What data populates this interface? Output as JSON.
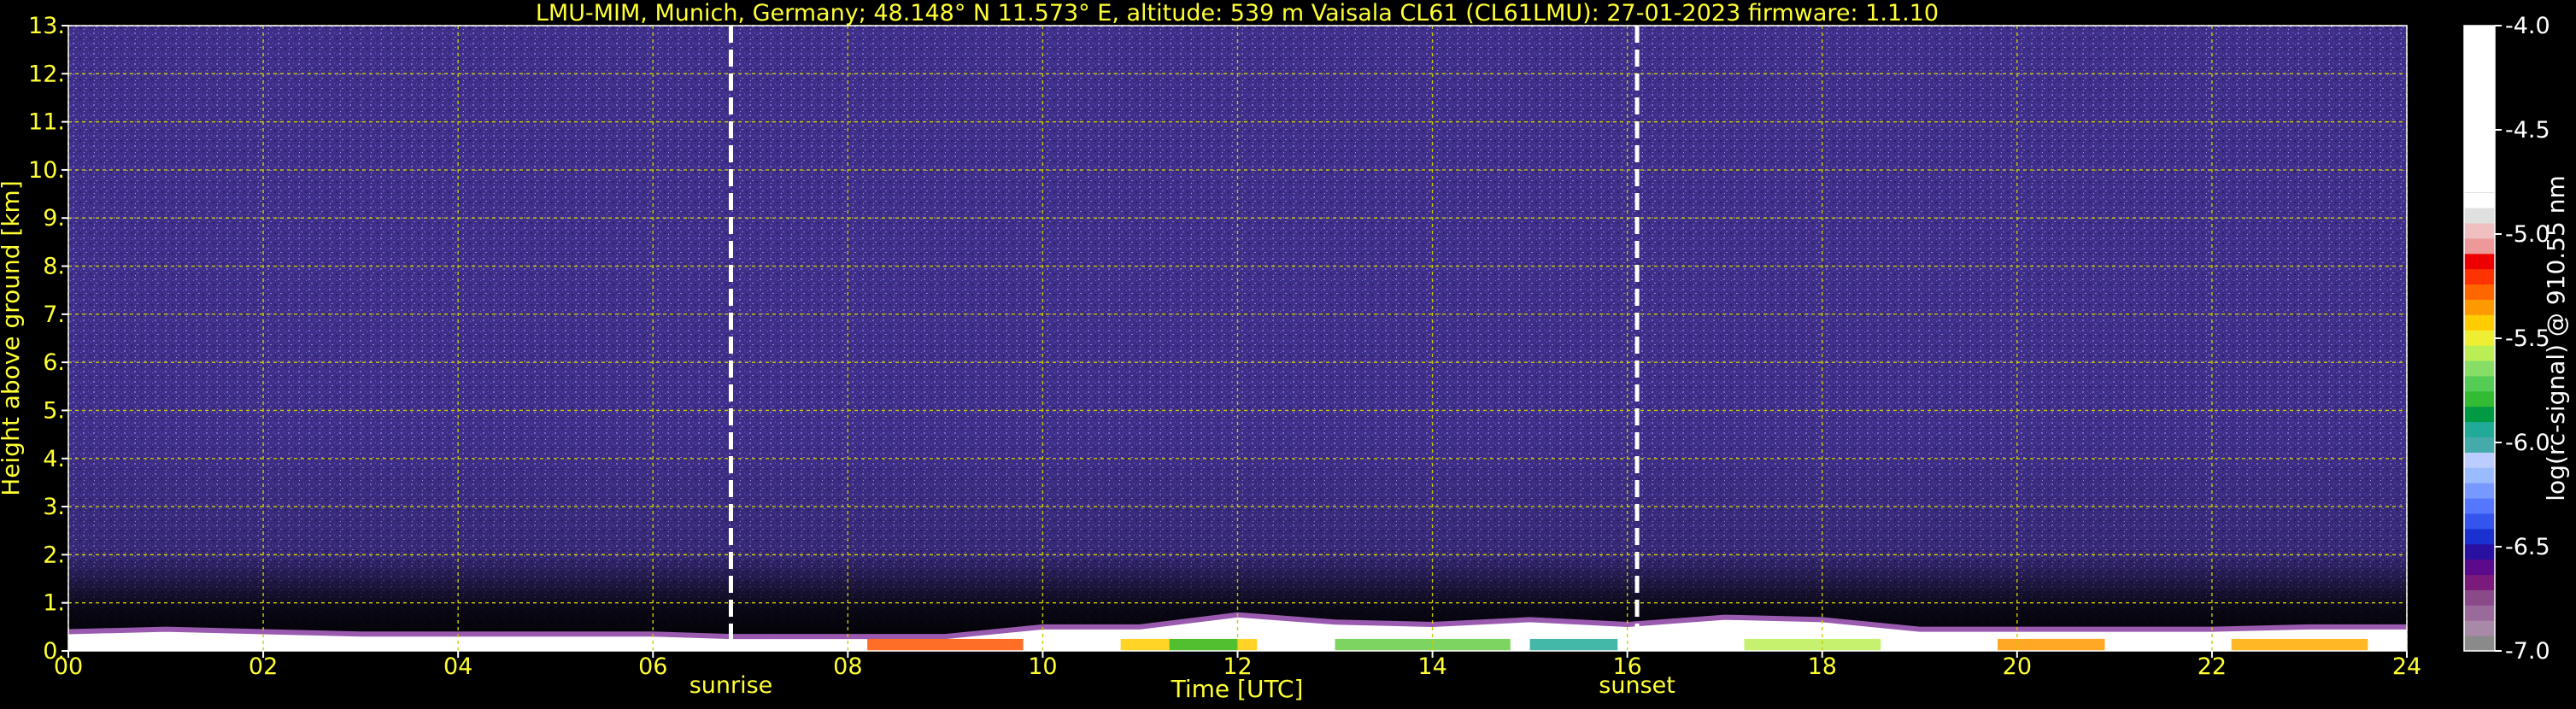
{
  "chart_data": {
    "type": "heatmap",
    "title": "LMU-MIM, Munich, Germany; 48.148° N 11.573° E, altitude: 539 m    Vaisala CL61 (CL61LMU): 27-01-2023    firmware: 1.1.10",
    "xlabel": "Time [UTC]",
    "ylabel": "Height above ground [km]",
    "xlim": [
      0,
      24
    ],
    "ylim": [
      0,
      13
    ],
    "x_ticks": [
      "00",
      "02",
      "04",
      "06",
      "08",
      "10",
      "12",
      "14",
      "16",
      "18",
      "20",
      "22",
      "24"
    ],
    "y_ticks": [
      "0.",
      "1.",
      "2.",
      "3.",
      "4.",
      "5.",
      "6.",
      "7.",
      "8.",
      "9.",
      "10.",
      "11.",
      "12.",
      "13."
    ],
    "grid": true,
    "markers": [
      {
        "label": "sunrise",
        "x": 6.8
      },
      {
        "label": "sunset",
        "x": 16.1
      }
    ],
    "colorbar": {
      "label": "log(rc-signal) @ 910.55 nm",
      "range": [
        -7.0,
        -4.0
      ],
      "ticks": [
        "-4.0",
        "-4.5",
        "-5.0",
        "-5.5",
        "-6.0",
        "-6.5",
        "-7.0"
      ],
      "colors": [
        "#8a8a8a",
        "#a88aa8",
        "#9a6a9a",
        "#8a4a8a",
        "#7a1a7a",
        "#5a0a8a",
        "#2a10a0",
        "#1a30d0",
        "#3355ee",
        "#5577ff",
        "#7799ff",
        "#99bbff",
        "#bbccff",
        "#44aaaa",
        "#22aa99",
        "#009944",
        "#33bb33",
        "#55cc55",
        "#88dd66",
        "#bbee55",
        "#eeee33",
        "#ffcc00",
        "#ff9900",
        "#ff6600",
        "#ff3300",
        "#ee0000",
        "#ee9999",
        "#f0c0c0",
        "#e0e0e0",
        "#ffffff"
      ]
    },
    "boundary_layer": {
      "x": [
        0,
        1,
        2,
        3,
        4,
        5,
        6,
        6.8,
        7,
        8,
        9,
        10,
        11,
        12,
        13,
        14,
        15,
        16,
        17,
        18,
        19,
        20,
        21,
        22,
        23,
        24
      ],
      "top_km": [
        0.4,
        0.45,
        0.4,
        0.35,
        0.35,
        0.35,
        0.35,
        0.3,
        0.3,
        0.3,
        0.3,
        0.5,
        0.5,
        0.75,
        0.6,
        0.55,
        0.65,
        0.55,
        0.7,
        0.65,
        0.45,
        0.45,
        0.45,
        0.45,
        0.5,
        0.5
      ]
    }
  }
}
